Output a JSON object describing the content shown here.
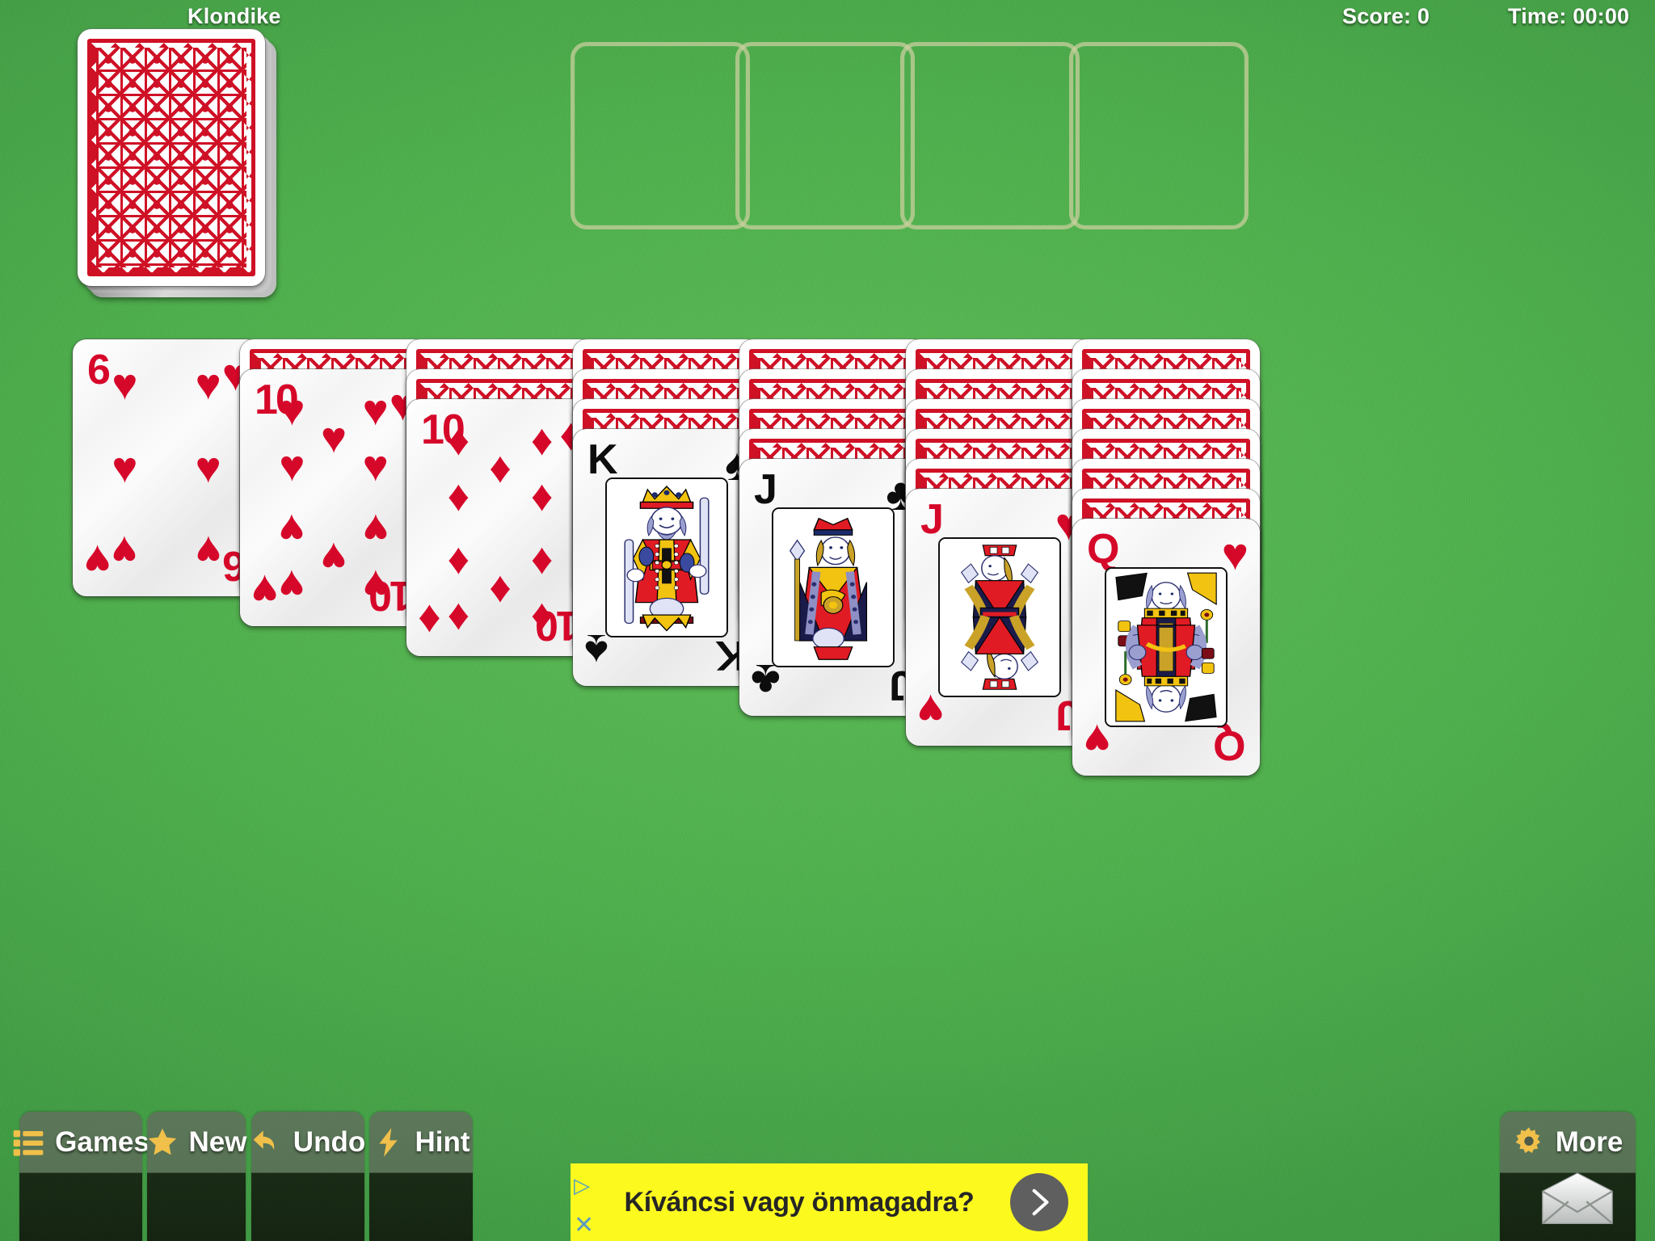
{
  "header": {
    "game_title": "Klondike",
    "score_label": "Score: 0",
    "time_label": "Time: 00:00"
  },
  "colors": {
    "felt_green": "#4cb24a",
    "card_red": "#d6082a",
    "card_back_red": "#cf1126",
    "foundation_outline": "#cdd0a0",
    "toolbar_icon_gold": "#f0c04a",
    "ad_yellow": "#fcf91f"
  },
  "stock": {
    "name": "stock-pile",
    "face_down": true,
    "card_back_pattern": "red-geometric-diamond-grid"
  },
  "waste": {
    "cards": []
  },
  "foundations": [
    {
      "index": 1,
      "suit": null,
      "empty": true
    },
    {
      "index": 2,
      "suit": null,
      "empty": true
    },
    {
      "index": 3,
      "suit": null,
      "empty": true
    },
    {
      "index": 4,
      "suit": null,
      "empty": true
    }
  ],
  "tableau": [
    {
      "index": 1,
      "face_down": 0,
      "face_up": [
        {
          "rank": "6",
          "suit": "hearts",
          "color": "red"
        }
      ]
    },
    {
      "index": 2,
      "face_down": 1,
      "face_up": [
        {
          "rank": "10",
          "suit": "hearts",
          "color": "red"
        }
      ]
    },
    {
      "index": 3,
      "face_down": 2,
      "face_up": [
        {
          "rank": "10",
          "suit": "diamonds",
          "color": "red"
        }
      ]
    },
    {
      "index": 4,
      "face_down": 3,
      "face_up": [
        {
          "rank": "K",
          "suit": "spades",
          "color": "black"
        }
      ]
    },
    {
      "index": 5,
      "face_down": 4,
      "face_up": [
        {
          "rank": "J",
          "suit": "clubs",
          "color": "black"
        }
      ]
    },
    {
      "index": 6,
      "face_down": 5,
      "face_up": [
        {
          "rank": "J",
          "suit": "hearts",
          "color": "red"
        }
      ]
    },
    {
      "index": 7,
      "face_down": 6,
      "face_up": [
        {
          "rank": "Q",
          "suit": "hearts",
          "color": "red"
        }
      ]
    }
  ],
  "toolbar": {
    "games_label": "Games",
    "games_icon": "list-icon",
    "new_label": "New",
    "new_icon": "star-icon",
    "undo_label": "Undo",
    "undo_icon": "undo-arrow-icon",
    "hint_label": "Hint",
    "hint_icon": "lightning-bolt-icon",
    "more_label": "More",
    "more_icon": "gear-icon",
    "mail_icon": "envelope-icon"
  },
  "ad": {
    "text": "Kíváncsi vagy önmagadra?",
    "arrow_icon": "chevron-right-icon",
    "adchoices_icon": "adchoices-icon",
    "close_icon": "close-x-icon"
  }
}
